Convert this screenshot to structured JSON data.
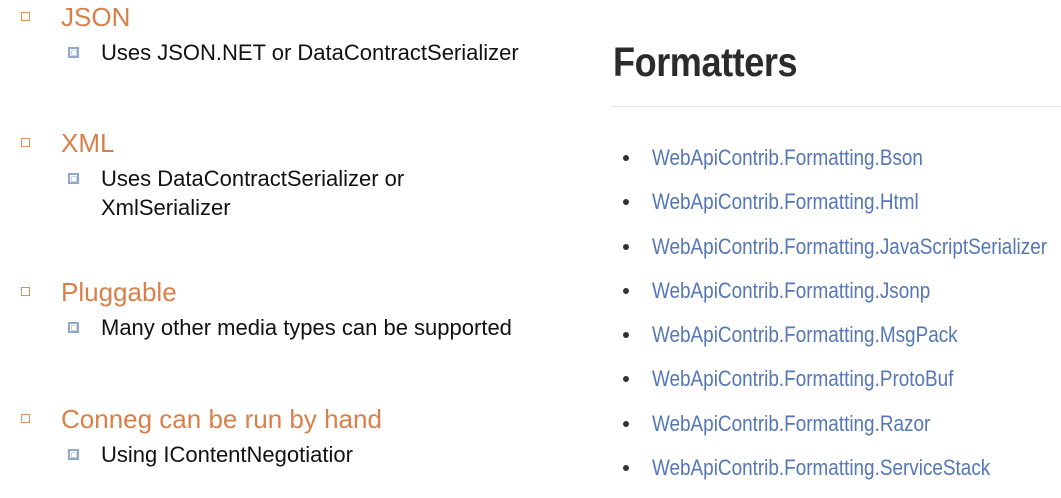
{
  "outline": {
    "sections": [
      {
        "heading": "JSON",
        "detail": "Uses JSON.NET or DataContractSerializer"
      },
      {
        "heading": "XML",
        "detail": "Uses DataContractSerializer or XmlSerializer"
      },
      {
        "heading": "Pluggable",
        "detail": "Many other media types can be supported"
      },
      {
        "heading": "Conneg can be run by hand",
        "detail": "Using IContentNegotiatior"
      }
    ]
  },
  "formatters": {
    "title": "Formatters",
    "items": [
      "WebApiContrib.Formatting.Bson",
      "WebApiContrib.Formatting.Html",
      "WebApiContrib.Formatting.JavaScriptSerializer",
      "WebApiContrib.Formatting.Jsonp",
      "WebApiContrib.Formatting.MsgPack",
      "WebApiContrib.Formatting.ProtoBuf",
      "WebApiContrib.Formatting.Razor",
      "WebApiContrib.Formatting.ServiceStack"
    ]
  },
  "colors": {
    "heading": "#d9804a",
    "sub_marker": "#8da8c9",
    "link": "#5577b5"
  }
}
